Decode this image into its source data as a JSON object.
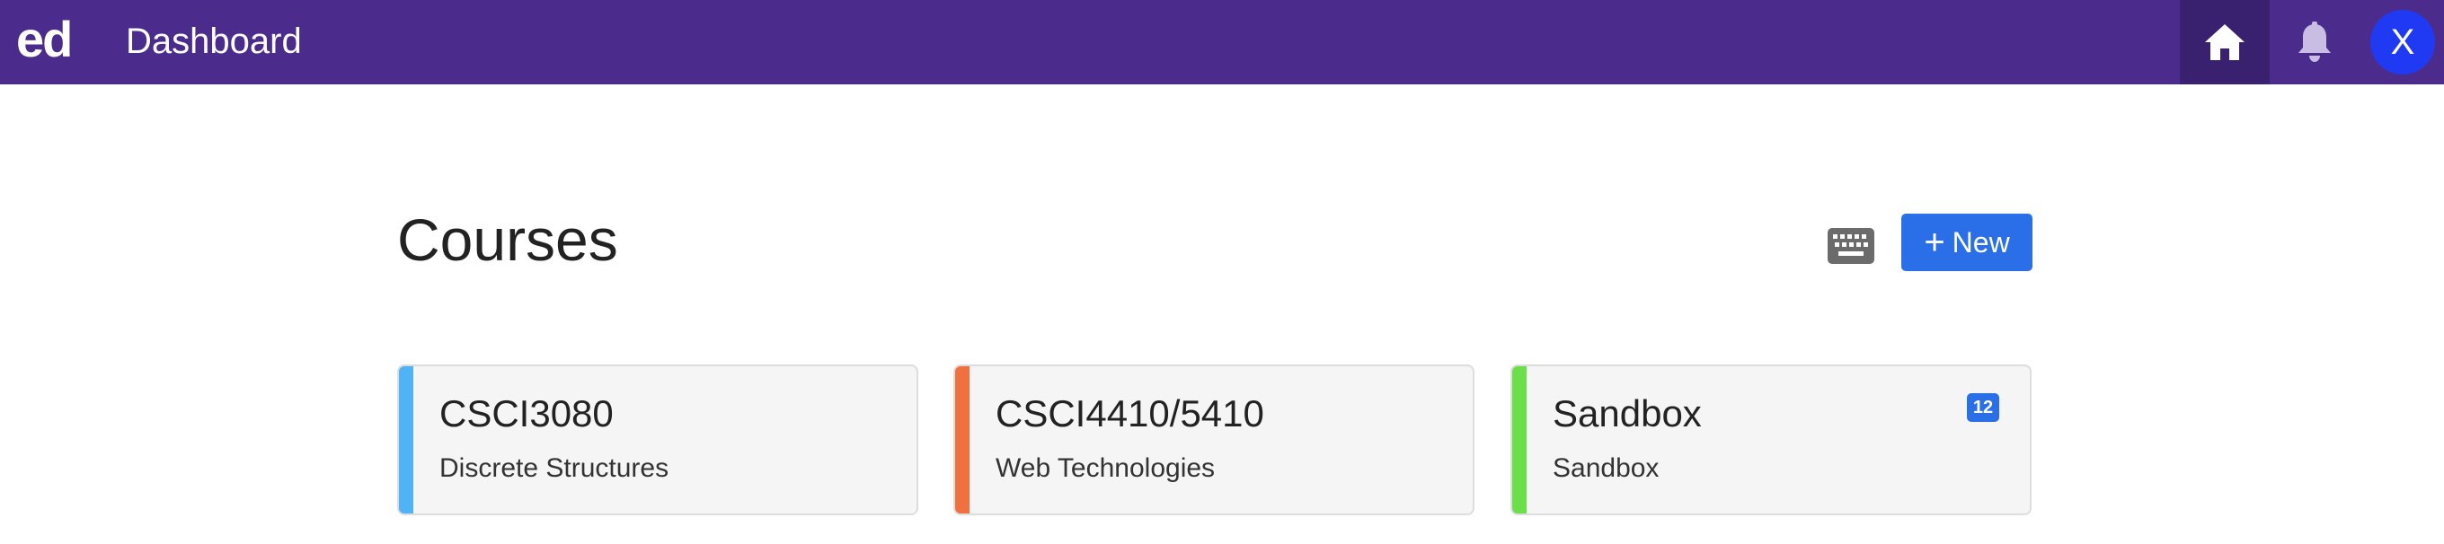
{
  "header": {
    "logo": "ed",
    "title": "Dashboard",
    "avatar_initial": "X",
    "colors": {
      "bar": "#4b2c8c",
      "active_nav": "#3a2170",
      "avatar": "#1f3af2"
    },
    "icons": {
      "home": "home-icon",
      "notifications": "bell-icon"
    }
  },
  "main": {
    "title": "Courses",
    "keyboard_icon": "keyboard-icon",
    "new_button": {
      "icon": "+",
      "label": "New",
      "color": "#2a6fe8"
    },
    "courses": [
      {
        "code": "CSCI3080",
        "name": "Discrete Structures",
        "color": "#4fb3f6",
        "badge": ""
      },
      {
        "code": "CSCI4410/5410",
        "name": "Web Technologies",
        "color": "#f07040",
        "badge": ""
      },
      {
        "code": "Sandbox",
        "name": "Sandbox",
        "color": "#6adf4a",
        "badge": "12"
      }
    ]
  }
}
